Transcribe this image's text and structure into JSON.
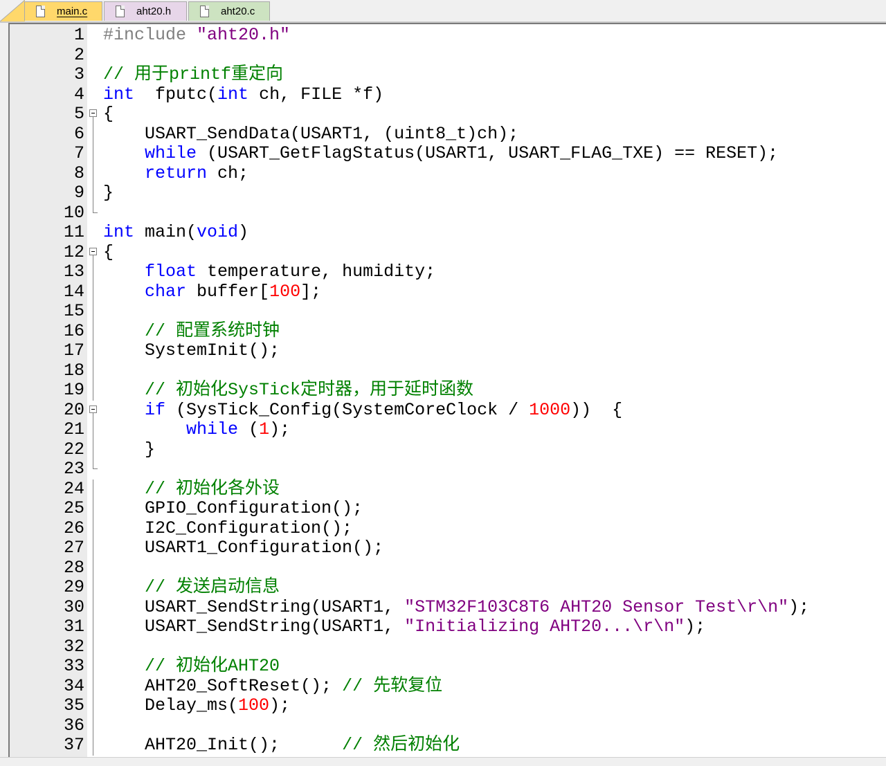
{
  "tabs": [
    {
      "label": "main.c",
      "active": true,
      "color": "#ffd86b"
    },
    {
      "label": "aht20.h",
      "active": false,
      "color": "#e7d6e9"
    },
    {
      "label": "aht20.c",
      "active": false,
      "color": "#cde3c1"
    }
  ],
  "colors": {
    "keyword": "#0000ff",
    "comment": "#008000",
    "string": "#800080",
    "number": "#ff0000",
    "preprocessor": "#808080"
  },
  "editor": {
    "lines": [
      {
        "n": "1",
        "fold": "",
        "tokens": [
          [
            "pp",
            "#include "
          ],
          [
            "str",
            "\"aht20.h\""
          ]
        ]
      },
      {
        "n": "2",
        "fold": "",
        "tokens": []
      },
      {
        "n": "3",
        "fold": "",
        "tokens": [
          [
            "cm",
            "// 用于printf重定向"
          ]
        ]
      },
      {
        "n": "4",
        "fold": "",
        "tokens": [
          [
            "kw",
            "int"
          ],
          [
            "",
            "  fputc("
          ],
          [
            "kw",
            "int"
          ],
          [
            "",
            " ch, FILE *f)"
          ]
        ]
      },
      {
        "n": "5",
        "fold": "open",
        "tokens": [
          [
            "",
            "{"
          ]
        ]
      },
      {
        "n": "6",
        "fold": "line",
        "tokens": [
          [
            "",
            "    USART_SendData(USART1, (uint8_t)ch);"
          ]
        ]
      },
      {
        "n": "7",
        "fold": "line",
        "tokens": [
          [
            "",
            "    "
          ],
          [
            "kw",
            "while"
          ],
          [
            "",
            " (USART_GetFlagStatus(USART1, USART_FLAG_TXE) == RESET);"
          ]
        ]
      },
      {
        "n": "8",
        "fold": "line",
        "tokens": [
          [
            "",
            "    "
          ],
          [
            "kw",
            "return"
          ],
          [
            "",
            " ch;"
          ]
        ]
      },
      {
        "n": "9",
        "fold": "line",
        "tokens": [
          [
            "",
            "}"
          ]
        ]
      },
      {
        "n": "10",
        "fold": "end",
        "tokens": []
      },
      {
        "n": "11",
        "fold": "",
        "tokens": [
          [
            "kw",
            "int"
          ],
          [
            "",
            " main("
          ],
          [
            "kw",
            "void"
          ],
          [
            "",
            ")"
          ]
        ]
      },
      {
        "n": "12",
        "fold": "open",
        "tokens": [
          [
            "",
            "{"
          ]
        ]
      },
      {
        "n": "13",
        "fold": "line",
        "tokens": [
          [
            "",
            "    "
          ],
          [
            "kw",
            "float"
          ],
          [
            "",
            " temperature, humidity;"
          ]
        ]
      },
      {
        "n": "14",
        "fold": "line",
        "tokens": [
          [
            "",
            "    "
          ],
          [
            "kw",
            "char"
          ],
          [
            "",
            " buffer["
          ],
          [
            "num",
            "100"
          ],
          [
            "",
            "];"
          ]
        ]
      },
      {
        "n": "15",
        "fold": "line",
        "tokens": []
      },
      {
        "n": "16",
        "fold": "line",
        "tokens": [
          [
            "",
            "    "
          ],
          [
            "cm",
            "// 配置系统时钟"
          ]
        ]
      },
      {
        "n": "17",
        "fold": "line",
        "tokens": [
          [
            "",
            "    SystemInit();"
          ]
        ]
      },
      {
        "n": "18",
        "fold": "line",
        "tokens": []
      },
      {
        "n": "19",
        "fold": "line",
        "tokens": [
          [
            "",
            "    "
          ],
          [
            "cm",
            "// 初始化SysTick定时器，用于延时函数"
          ]
        ]
      },
      {
        "n": "20",
        "fold": "open",
        "tokens": [
          [
            "",
            "    "
          ],
          [
            "kw",
            "if"
          ],
          [
            "",
            " (SysTick_Config(SystemCoreClock / "
          ],
          [
            "num",
            "1000"
          ],
          [
            "",
            "))  {"
          ]
        ]
      },
      {
        "n": "21",
        "fold": "line",
        "tokens": [
          [
            "",
            "        "
          ],
          [
            "kw",
            "while"
          ],
          [
            "",
            " ("
          ],
          [
            "num",
            "1"
          ],
          [
            "",
            ");"
          ]
        ]
      },
      {
        "n": "22",
        "fold": "line",
        "tokens": [
          [
            "",
            "    }"
          ]
        ]
      },
      {
        "n": "23",
        "fold": "end",
        "tokens": []
      },
      {
        "n": "24",
        "fold": "line",
        "tokens": [
          [
            "",
            "    "
          ],
          [
            "cm",
            "// 初始化各外设"
          ]
        ]
      },
      {
        "n": "25",
        "fold": "line",
        "tokens": [
          [
            "",
            "    GPIO_Configuration();"
          ]
        ]
      },
      {
        "n": "26",
        "fold": "line",
        "tokens": [
          [
            "",
            "    I2C_Configuration();"
          ]
        ]
      },
      {
        "n": "27",
        "fold": "line",
        "tokens": [
          [
            "",
            "    USART1_Configuration();"
          ]
        ]
      },
      {
        "n": "28",
        "fold": "line",
        "tokens": []
      },
      {
        "n": "29",
        "fold": "line",
        "tokens": [
          [
            "",
            "    "
          ],
          [
            "cm",
            "// 发送启动信息"
          ]
        ]
      },
      {
        "n": "30",
        "fold": "line",
        "tokens": [
          [
            "",
            "    USART_SendString(USART1, "
          ],
          [
            "str",
            "\"STM32F103C8T6 AHT20 Sensor Test\\r\\n\""
          ],
          [
            "",
            ");"
          ]
        ]
      },
      {
        "n": "31",
        "fold": "line",
        "tokens": [
          [
            "",
            "    USART_SendString(USART1, "
          ],
          [
            "str",
            "\"Initializing AHT20...\\r\\n\""
          ],
          [
            "",
            ");"
          ]
        ]
      },
      {
        "n": "32",
        "fold": "line",
        "tokens": []
      },
      {
        "n": "33",
        "fold": "line",
        "tokens": [
          [
            "",
            "    "
          ],
          [
            "cm",
            "// 初始化AHT20"
          ]
        ]
      },
      {
        "n": "34",
        "fold": "line",
        "tokens": [
          [
            "",
            "    AHT20_SoftReset(); "
          ],
          [
            "cm",
            "// 先软复位"
          ]
        ]
      },
      {
        "n": "35",
        "fold": "line",
        "tokens": [
          [
            "",
            "    Delay_ms("
          ],
          [
            "num",
            "100"
          ],
          [
            "",
            ");"
          ]
        ]
      },
      {
        "n": "36",
        "fold": "line",
        "tokens": []
      },
      {
        "n": "37",
        "fold": "line",
        "tokens": [
          [
            "",
            "    AHT20_Init();      "
          ],
          [
            "cm",
            "// 然后初始化"
          ]
        ]
      }
    ]
  }
}
